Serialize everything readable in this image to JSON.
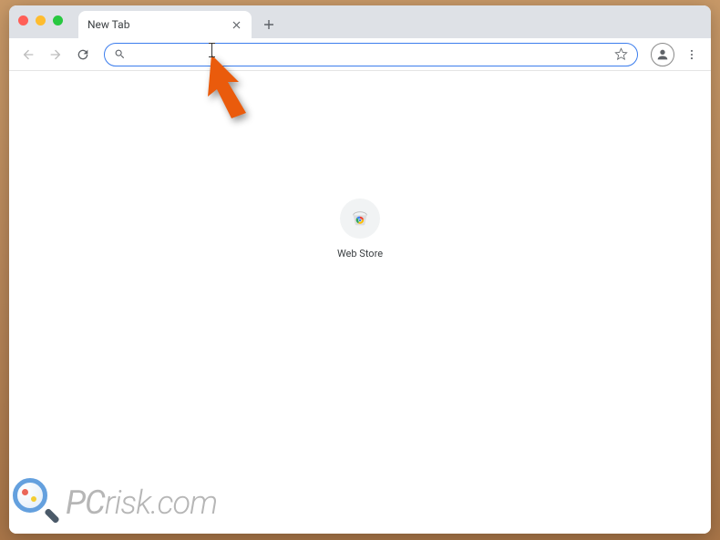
{
  "tab": {
    "title": "New Tab"
  },
  "omnibox": {
    "value": "",
    "placeholder": ""
  },
  "shortcut": {
    "label": "Web Store"
  },
  "watermark": {
    "text_pc": "PC",
    "text_rest": "risk.com"
  },
  "colors": {
    "arrow": "#ea5b0c",
    "omnibox_border": "#3b7ded"
  }
}
